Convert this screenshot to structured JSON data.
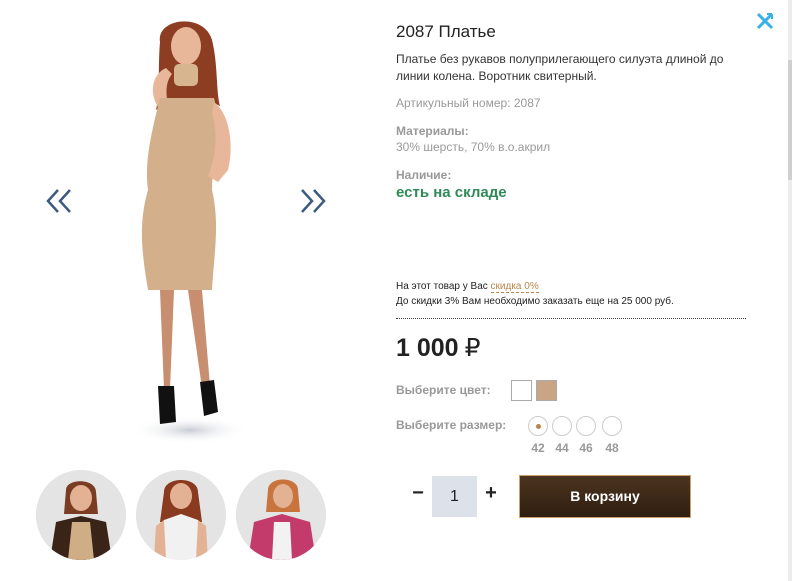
{
  "product": {
    "title": "2087 Платье",
    "description": "Платье без рукавов полуприлегающего силуэта длиной до линии колена. Воротник свитерный.",
    "sku": "Артикульный номер: 2087",
    "materials_label": "Материалы:",
    "materials_value": "30% шерсть, 70% в.о.акрил",
    "stock_label": "Наличие:",
    "stock_value": "есть на складе"
  },
  "discount": {
    "line1_prefix": "На этот товар у Вас ",
    "line1_link": "скидка 0%",
    "line2": "До скидки 3% Вам необходимо заказать еще на 25 000 руб."
  },
  "price": {
    "amount": "1 000",
    "currency": "₽"
  },
  "color": {
    "label": "Выберите цвет:",
    "options": [
      {
        "name": "white",
        "hex": "#ffffff"
      },
      {
        "name": "beige",
        "hex": "#c9a585"
      }
    ]
  },
  "size": {
    "label": "Выберите размер:",
    "options": [
      "42",
      "44",
      "46",
      "48"
    ],
    "selected": "42"
  },
  "quantity": {
    "minus": "−",
    "value": "1",
    "plus": "+"
  },
  "cart": {
    "label": "В корзину"
  },
  "gallery": {
    "prev_icon": "double-chevron-left-icon",
    "next_icon": "double-chevron-right-icon",
    "thumbnails": [
      "black-cardigan",
      "white-sleeveless-top",
      "pink-cardigan"
    ]
  },
  "colors": {
    "arrow": "#3d5a80",
    "close": "#3ab0e8",
    "stock": "#2e8b57",
    "accent": "#b8864b",
    "button": "#3d2817"
  }
}
